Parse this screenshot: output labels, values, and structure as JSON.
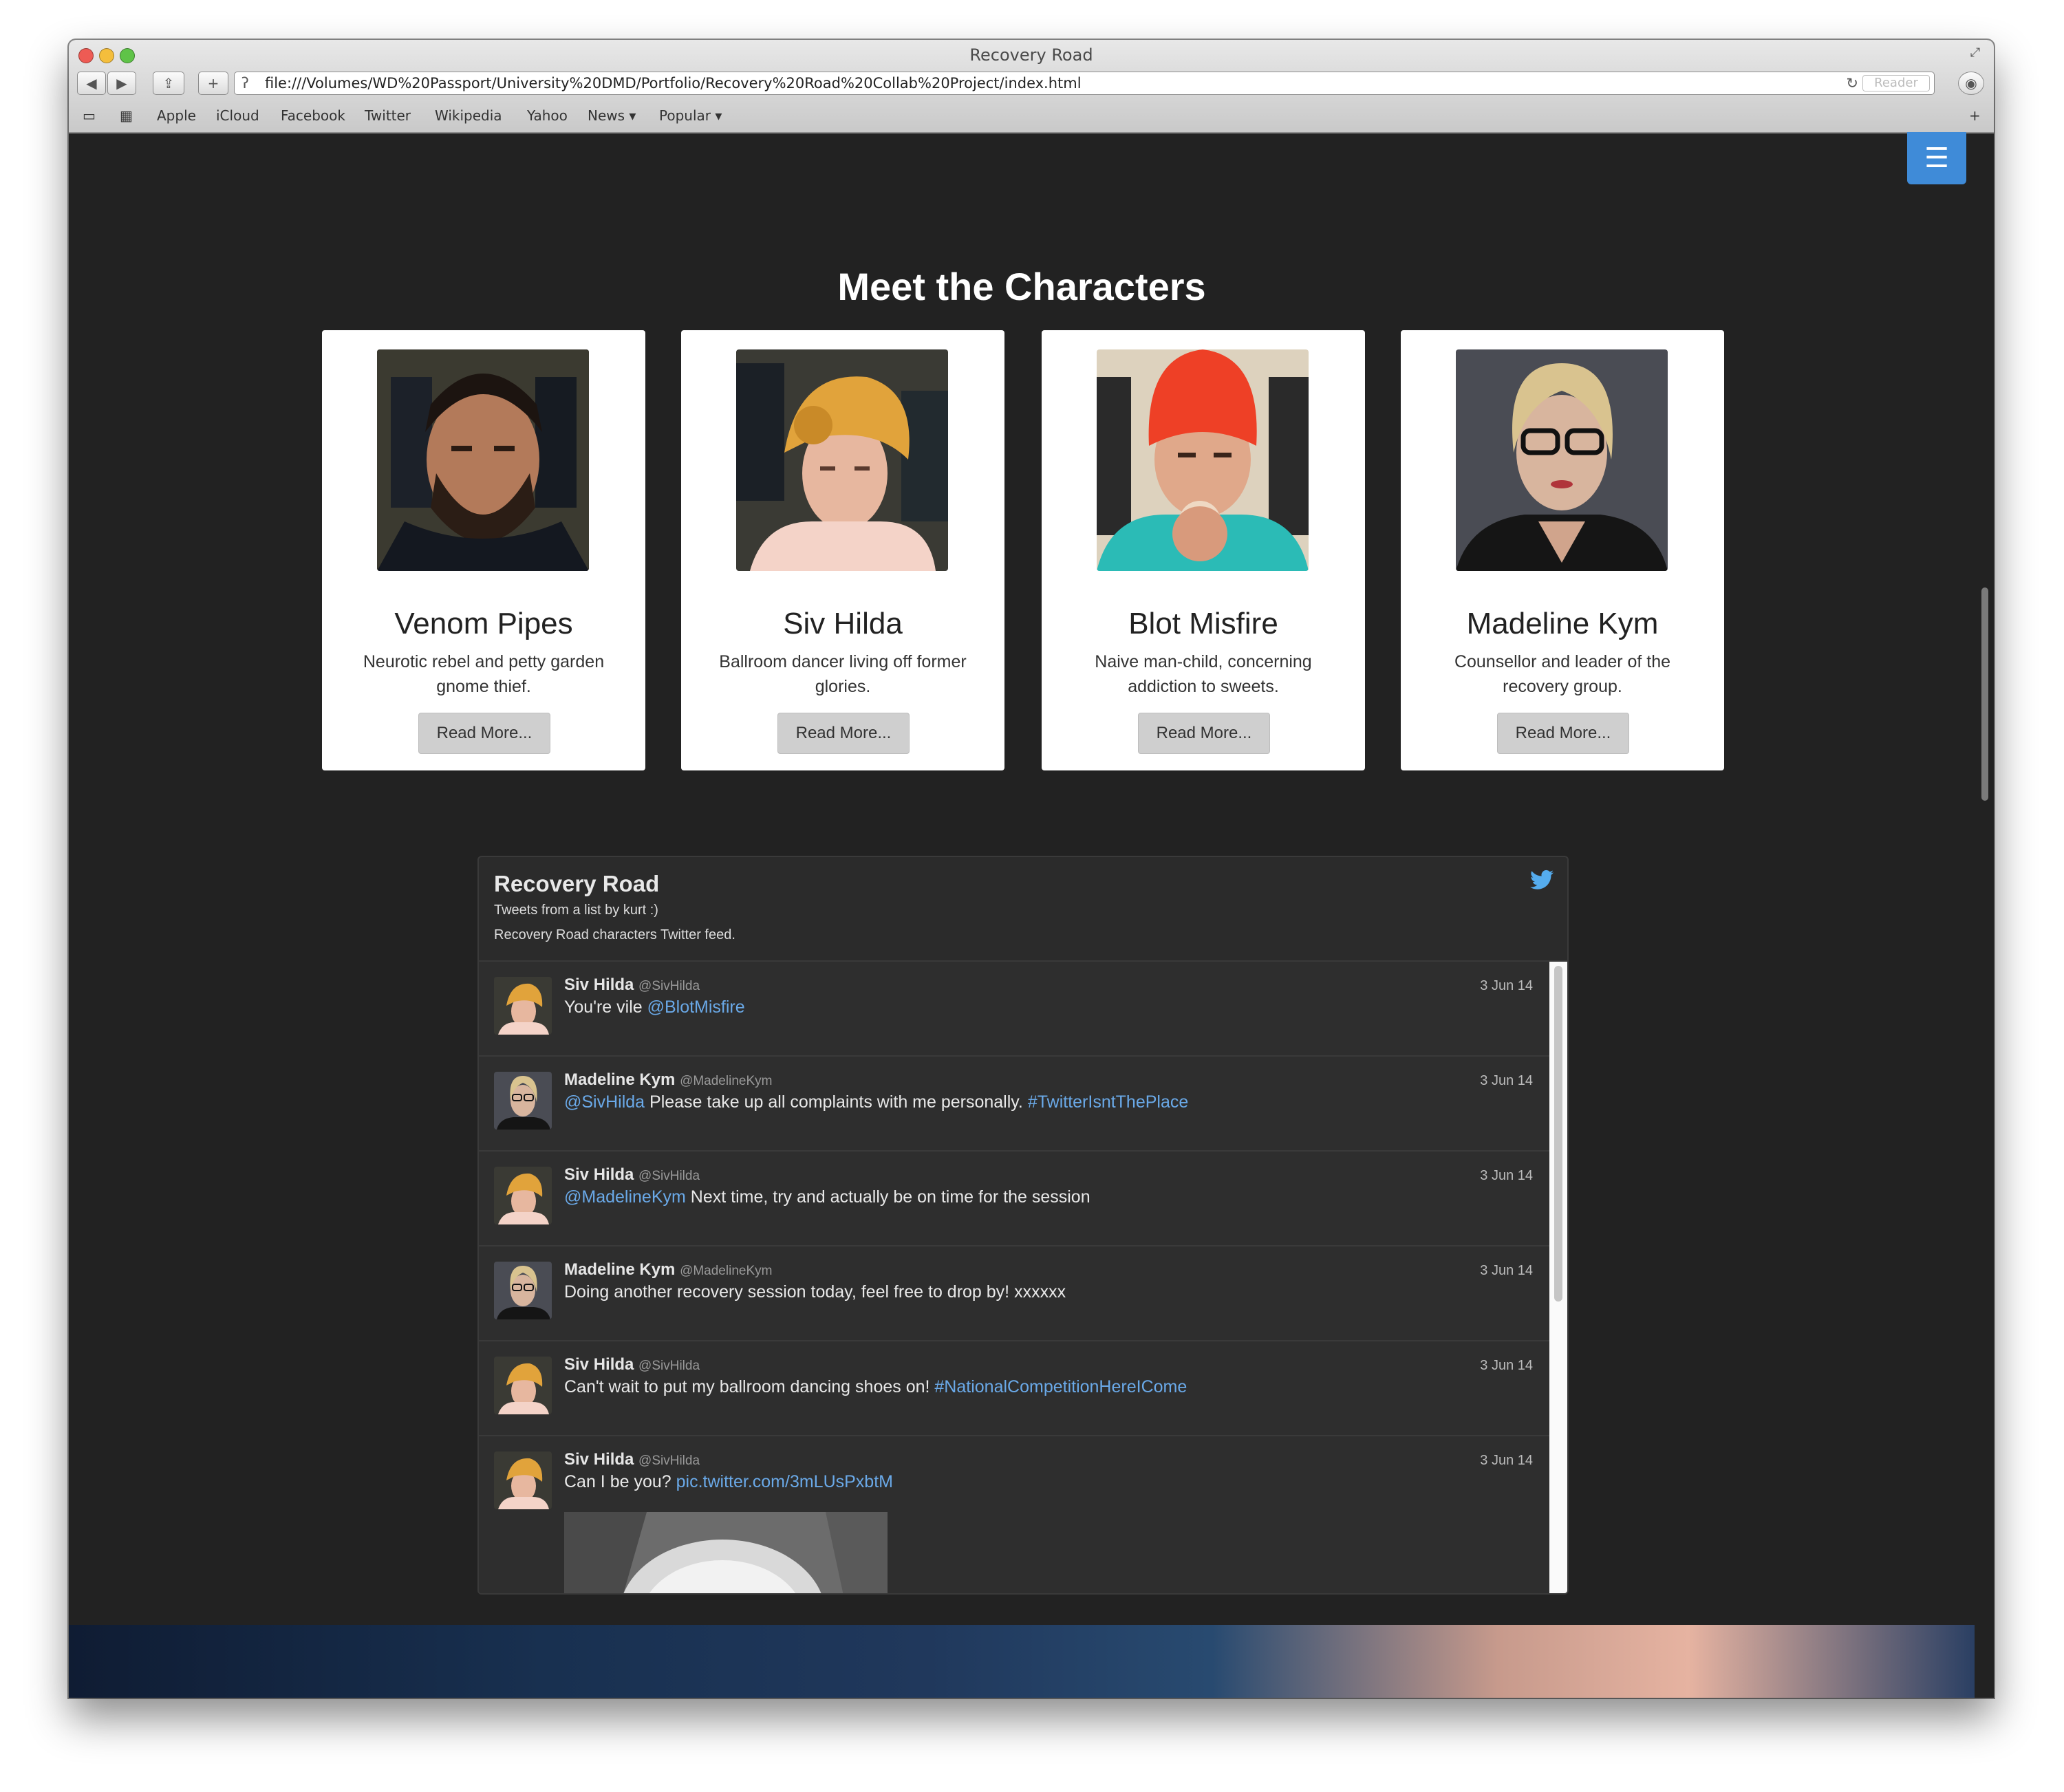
{
  "window": {
    "title": "Recovery Road",
    "url": "file:///Volumes/WD%20Passport/University%20DMD/Portfolio/Recovery%20Road%20Collab%20Project/index.html",
    "reader_label": "Reader",
    "bookmarks": [
      "Apple",
      "iCloud",
      "Facebook",
      "Twitter",
      "Wikipedia",
      "Yahoo",
      "News ▾",
      "Popular ▾"
    ]
  },
  "page": {
    "section_title": "Meet the Characters",
    "cards": [
      {
        "name": "Venom Pipes",
        "description": "Neurotic rebel and petty garden gnome thief.",
        "button": "Read More..."
      },
      {
        "name": "Siv Hilda",
        "description": "Ballroom dancer living off former glories.",
        "button": "Read More..."
      },
      {
        "name": "Blot Misfire",
        "description": "Naive man-child, concerning addiction to sweets.",
        "button": "Read More..."
      },
      {
        "name": "Madeline Kym",
        "description": "Counsellor and leader of the recovery group.",
        "button": "Read More..."
      }
    ]
  },
  "twitter": {
    "title": "Recovery Road",
    "subtitle": "Tweets from a list by kurt :)",
    "description": "Recovery Road characters Twitter feed.",
    "tweets": [
      {
        "name": "Siv Hilda",
        "handle": "@SivHilda",
        "date": "3 Jun 14",
        "pre": "You're vile ",
        "link1": "@BlotMisfire",
        "mid": "",
        "link2": ""
      },
      {
        "name": "Madeline Kym",
        "handle": "@MadelineKym",
        "date": "3 Jun 14",
        "pre": "",
        "link1": "@SivHilda",
        "mid": " Please take up all complaints with me personally. ",
        "link2": "#TwitterIsntThePlace"
      },
      {
        "name": "Siv Hilda",
        "handle": "@SivHilda",
        "date": "3 Jun 14",
        "pre": "",
        "link1": "@MadelineKym",
        "mid": " Next time, try and actually be on time for the session",
        "link2": ""
      },
      {
        "name": "Madeline Kym",
        "handle": "@MadelineKym",
        "date": "3 Jun 14",
        "pre": "Doing another recovery session today, feel free to drop by! xxxxxx",
        "link1": "",
        "mid": "",
        "link2": ""
      },
      {
        "name": "Siv Hilda",
        "handle": "@SivHilda",
        "date": "3 Jun 14",
        "pre": "Can't wait to put my ballroom dancing shoes on! ",
        "link1": "#NationalCompetitionHereICome",
        "mid": "",
        "link2": ""
      },
      {
        "name": "Siv Hilda",
        "handle": "@SivHilda",
        "date": "3 Jun 14",
        "pre": "Can I be you? ",
        "link1": "pic.twitter.com/3mLUsPxbtM",
        "mid": "",
        "link2": ""
      }
    ]
  },
  "colors": {
    "page_background": "#222222",
    "menu_button": "#3f8bd8",
    "link": "#6aa9e8",
    "card": "#ffffff"
  },
  "icons": [
    "menu-icon",
    "twitter-bird-icon",
    "back-icon",
    "forward-icon",
    "share-icon",
    "add-tab-icon",
    "reload-icon",
    "reading-list-icon",
    "top-sites-icon"
  ]
}
